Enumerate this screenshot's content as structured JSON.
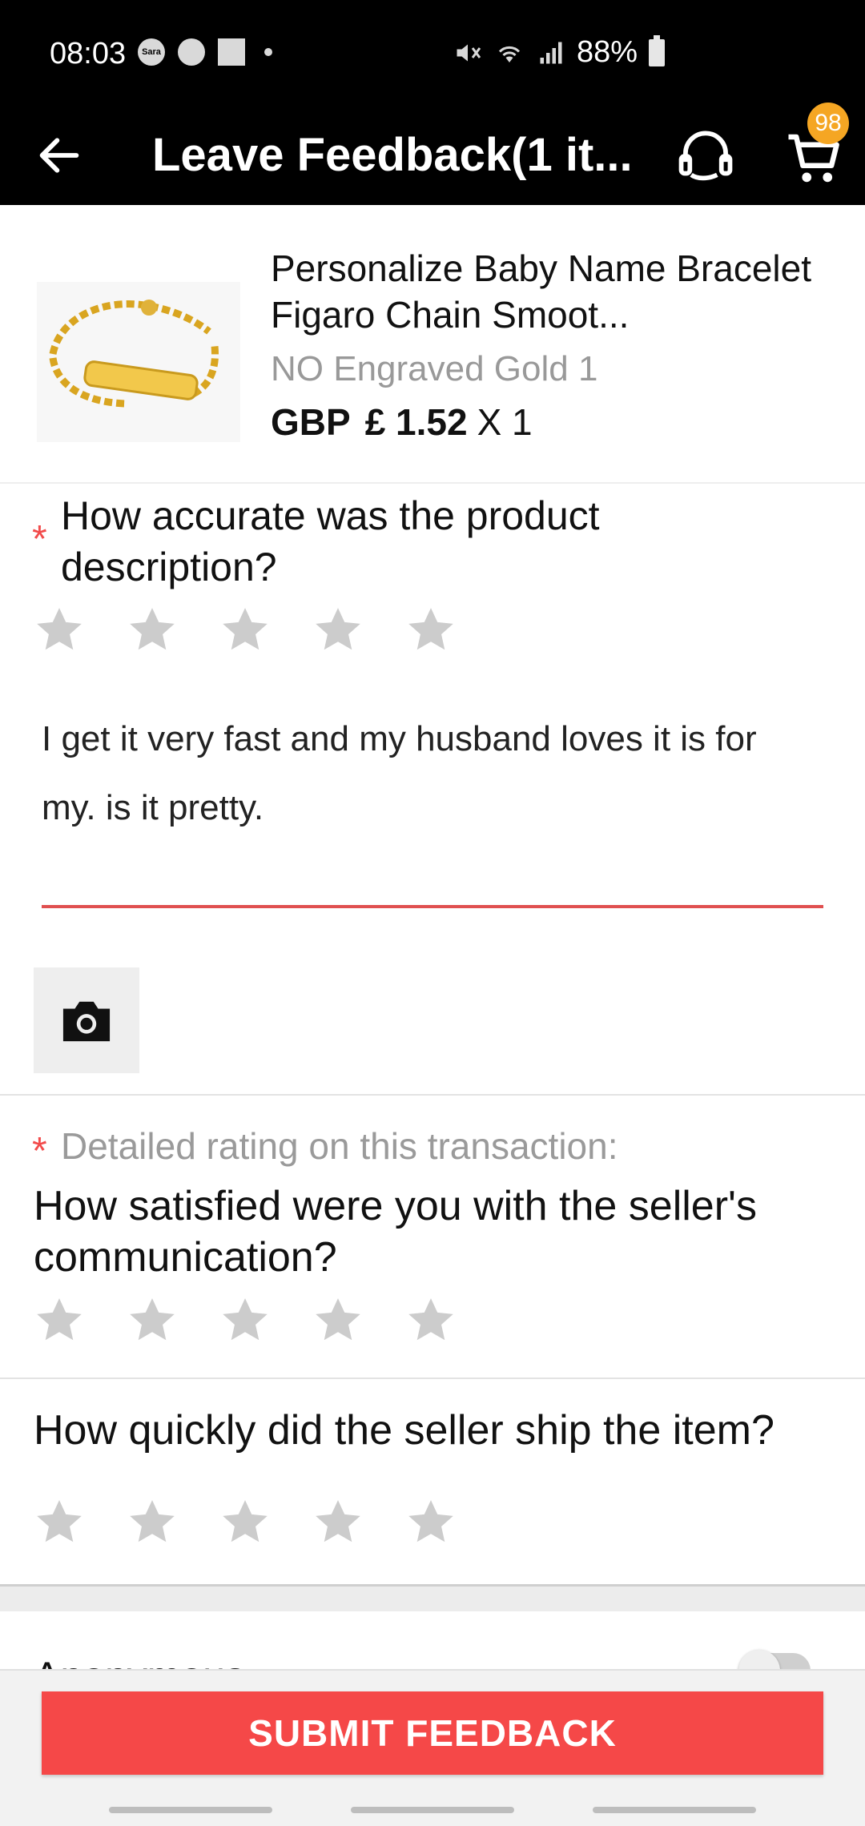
{
  "status_bar": {
    "time": "08:03",
    "left_badge_text": "Sara",
    "battery": "88%"
  },
  "app_bar": {
    "title": "Leave Feedback(1 it...",
    "cart_badge": "98"
  },
  "product": {
    "name": "Personalize Baby Name Bracelet Figaro Chain Smoot...",
    "variant": "NO Engraved Gold 1",
    "currency": "GBP",
    "price": "£ 1.52",
    "quantity": "X 1"
  },
  "questions": {
    "description": {
      "required_mark": "*",
      "text": "How accurate was the product description?",
      "rating": 0,
      "max_rating": 5
    },
    "review_text": "I get it very fast and my husband loves it is for my. is it pretty.",
    "detail_label": "Detailed rating on this transaction:",
    "detail_required_mark": "*",
    "communication": {
      "text": "How satisfied were you with the seller's communication?",
      "rating": 0,
      "max_rating": 5
    },
    "shipping": {
      "text": "How quickly did the seller ship the item?",
      "rating": 0,
      "max_rating": 5
    }
  },
  "anonymous": {
    "label": "Anonymous",
    "enabled": false
  },
  "submit": {
    "label": "SUBMIT FEEDBACK"
  },
  "colors": {
    "accent": "#f54848",
    "required": "#f24b4b",
    "badge": "#f5a623",
    "star_empty": "#cccccc"
  }
}
